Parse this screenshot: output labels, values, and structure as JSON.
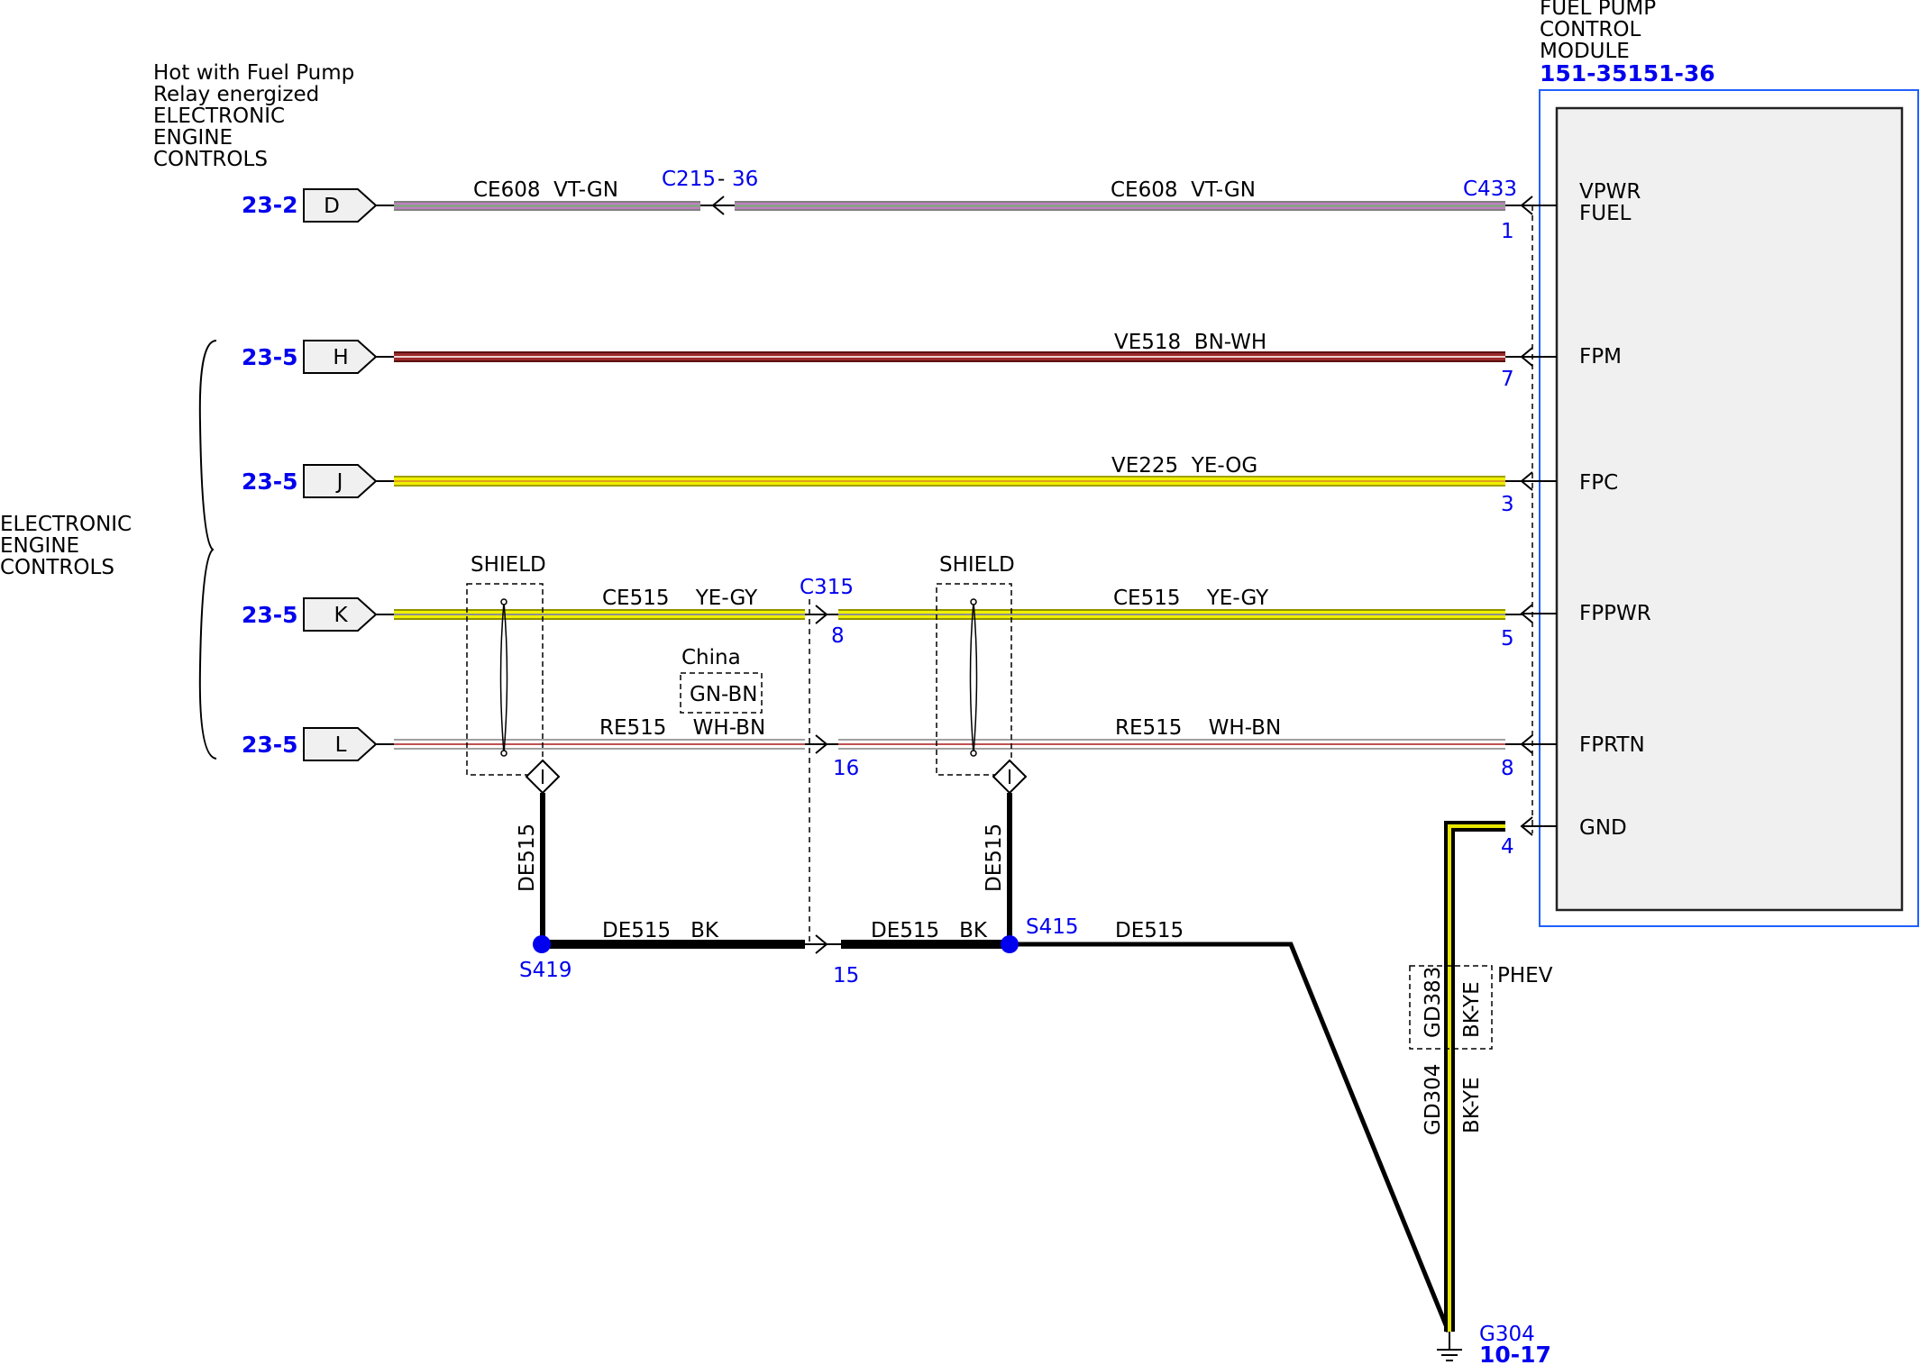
{
  "left_note": {
    "lines": [
      "Hot with Fuel Pump",
      "Relay energized",
      "ELECTRONIC",
      "ENGINE",
      "CONTROLS"
    ]
  },
  "left_group_label": {
    "lines": [
      "ELECTRONIC",
      "ENGINE",
      "CONTROLS"
    ]
  },
  "module": {
    "title_lines": [
      "FUEL PUMP",
      "CONTROL",
      "MODULE"
    ],
    "ref": "151-35151-36",
    "pins": [
      {
        "label": "VPWR",
        "label2": "FUEL",
        "num": "1"
      },
      {
        "label": "FPM",
        "num": "7"
      },
      {
        "label": "FPC",
        "num": "3"
      },
      {
        "label": "FPPWR",
        "num": "5"
      },
      {
        "label": "FPRTN",
        "num": "8"
      },
      {
        "label": "GND",
        "num": "4"
      }
    ]
  },
  "left_connectors": [
    {
      "page_ref": "23-2",
      "pin": "D"
    },
    {
      "page_ref": "23-5",
      "pin": "H"
    },
    {
      "page_ref": "23-5",
      "pin": "J"
    },
    {
      "page_ref": "23-5",
      "pin": "K"
    },
    {
      "page_ref": "23-5",
      "pin": "L"
    }
  ],
  "wires": {
    "w1_left": "CE608  VT-GN",
    "w1_right": "CE608  VT-GN",
    "w2": "VE518  BN-WH",
    "w3": "VE225  YE-OG",
    "w4_left": "CE515    YE-GY",
    "w4_right": "CE515    YE-GY",
    "w5_left": "RE515    WH-BN",
    "w5_right": "RE515    WH-BN",
    "drain1": "DE515",
    "drain2": "DE515",
    "bottom_left": "DE515   BK",
    "bottom_mid": "DE515   BK",
    "bottom_right": "DE515",
    "gnd_main_code": "GD304",
    "gnd_main_color": "BK-YE",
    "gnd_alt_code": "GD383",
    "gnd_alt_color": "BK-YE",
    "gnd_alt_note": "PHEV"
  },
  "connectors": {
    "c215": "C215",
    "c215_pin": "36",
    "c433": "C433",
    "c315": "C315",
    "c315_pin_a": "8",
    "c315_pin_b": "16",
    "c315_pin_c": "15"
  },
  "splices": {
    "s419": "S419",
    "s415": "S415"
  },
  "shields": {
    "left": "SHIELD",
    "right": "SHIELD"
  },
  "china_option": {
    "label": "China",
    "color": "GN-BN"
  },
  "ground": {
    "id": "G304",
    "ref": "10-17"
  },
  "colors": {
    "blue": "#0000ee",
    "violet_green": "#c080c0",
    "brown_white": "#8b2020",
    "yellow": "#e6e600",
    "white_brown": "#d8a0a0"
  }
}
